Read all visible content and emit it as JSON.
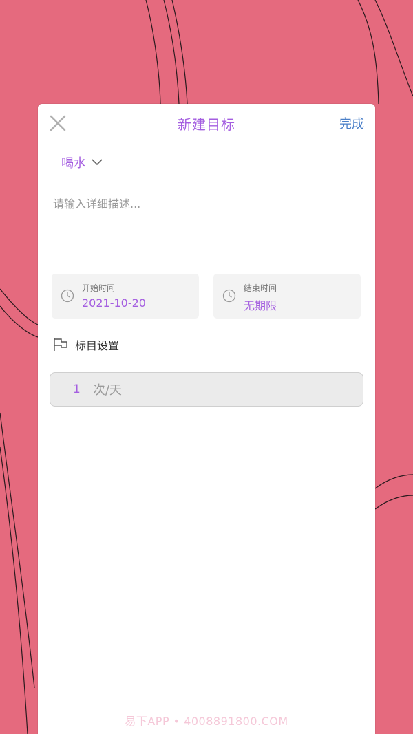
{
  "header": {
    "title": "新建目标",
    "done_label": "完成"
  },
  "category": {
    "label": "喝水"
  },
  "description": {
    "placeholder": "请输入详细描述...",
    "value": ""
  },
  "start_time": {
    "caption": "开始时间",
    "value": "2021-10-20"
  },
  "end_time": {
    "caption": "结束时间",
    "value": "无期限"
  },
  "target": {
    "label": "标目设置",
    "count": "1",
    "unit": "次/天"
  },
  "watermark": "易下APP • 4008891800.COM",
  "colors": {
    "background": "#e56a7e",
    "accent": "#a45ee0",
    "done": "#4a7fc8"
  }
}
